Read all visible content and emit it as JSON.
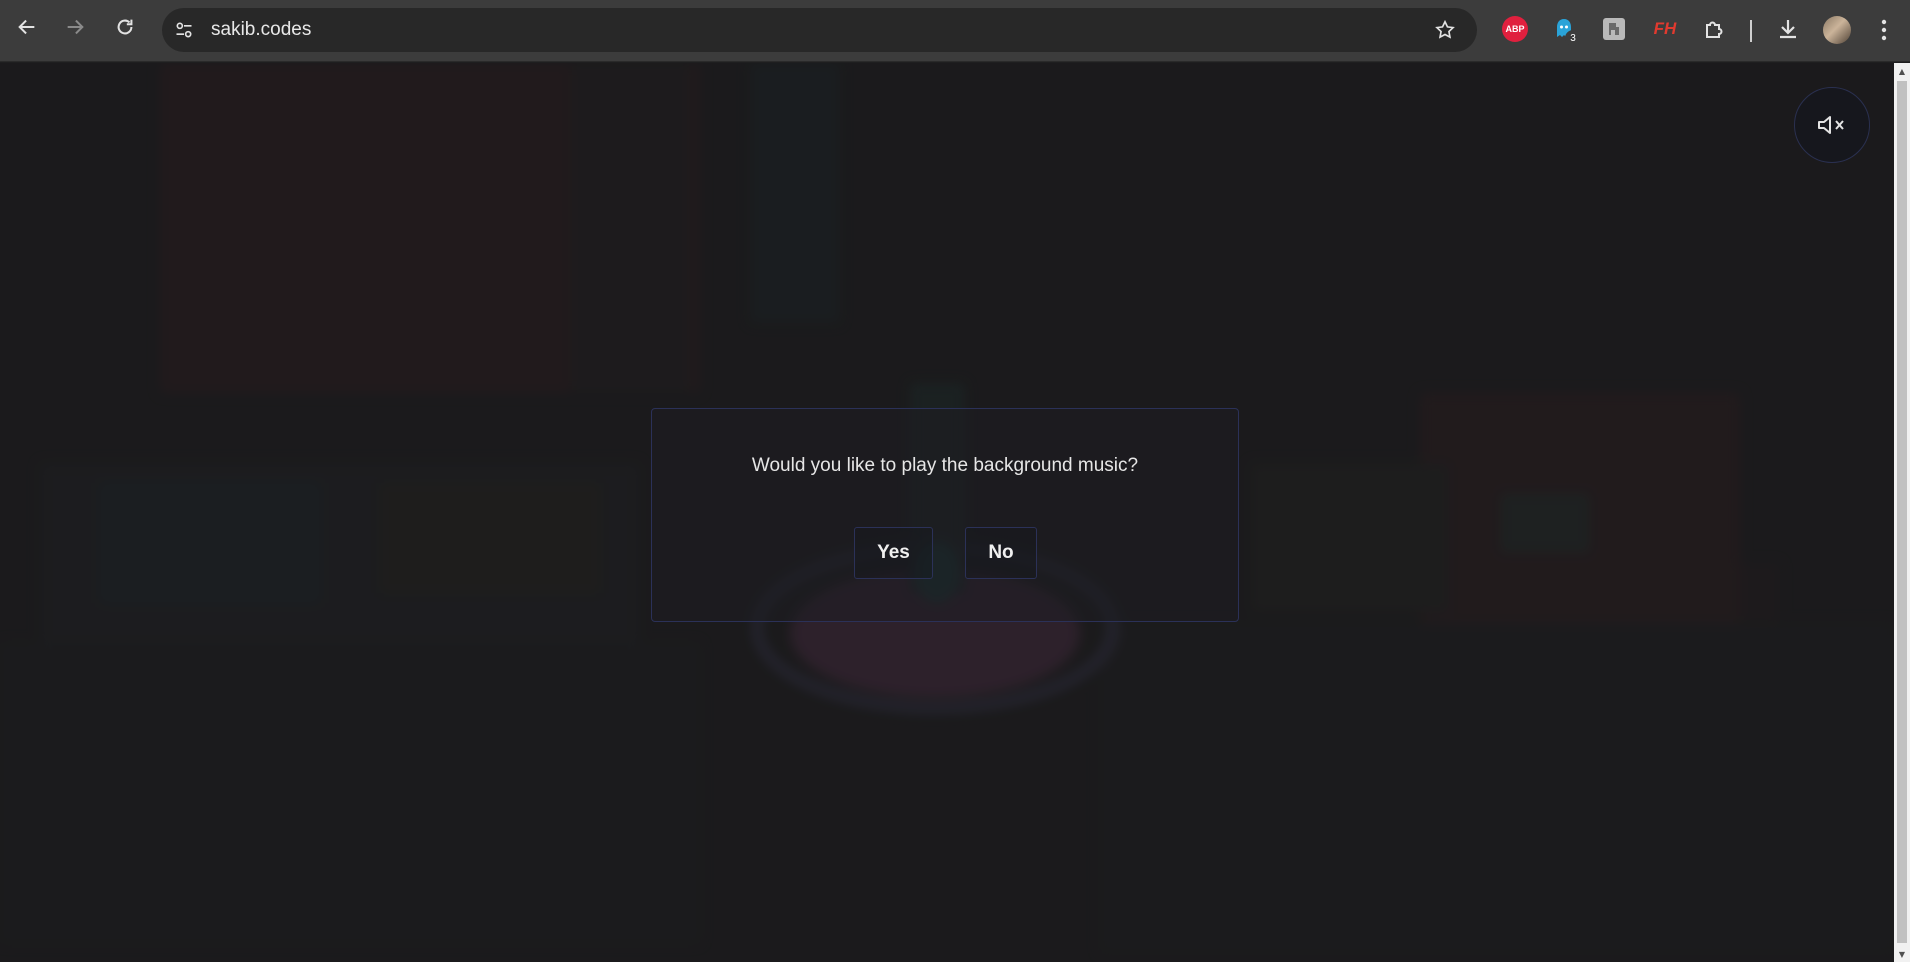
{
  "browser": {
    "url": "sakib.codes",
    "extensions": [
      {
        "name": "adblock-plus",
        "label": "ABP"
      },
      {
        "name": "ghostery",
        "badge": "3"
      },
      {
        "name": "puzzle-ext"
      },
      {
        "name": "fh-ext",
        "label": "FH"
      }
    ],
    "icons": {
      "back": "arrow-left-icon",
      "forward": "arrow-right-icon",
      "reload": "reload-icon",
      "site_info": "tune-icon",
      "bookmark": "star-icon",
      "extensions": "puzzle-icon",
      "downloads": "download-icon",
      "menu": "kebab-menu-icon"
    },
    "colors": {
      "toolbar": "#3c3c3c",
      "omnibox": "#282828",
      "abp": "#e0203e",
      "fh": "#e03a2f"
    }
  },
  "page": {
    "mute_icon": "speaker-muted-icon",
    "dialog": {
      "question": "Would you like to play the background music?",
      "yes_label": "Yes",
      "no_label": "No"
    },
    "colors": {
      "background": "#1f1e1f",
      "dialog_border": "#2b3158"
    }
  }
}
